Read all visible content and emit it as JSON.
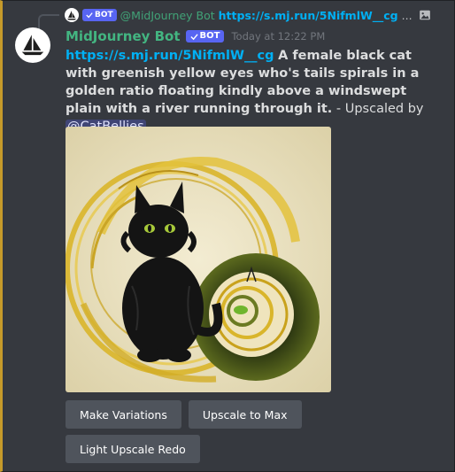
{
  "reply": {
    "bot_tag": "BOT",
    "username": "@MidJourney Bot",
    "link": "https://s.mj.run/5NifmlW__cg",
    "ellipsis": "..."
  },
  "message": {
    "username": "MidJourney Bot",
    "bot_tag": "BOT",
    "timestamp": "Today at 12:22 PM",
    "link": "https://s.mj.run/5NifmlW__cg",
    "prompt": "A female black cat with greenish yellow eyes who's tails spirals in a golden ratio floating kindly above a windswept plain with a river running through it.",
    "suffix": " - Upscaled by ",
    "mention": "@CatBellies"
  },
  "buttons": {
    "make_variations": "Make Variations",
    "upscale_to_max": "Upscale to Max",
    "light_upscale_redo": "Light Upscale Redo"
  },
  "icons": {
    "avatar": "sailboat-icon",
    "check": "check-icon",
    "image": "image-icon"
  },
  "colors": {
    "background": "#36393f",
    "username": "#43b581",
    "link": "#00b0f4",
    "bot_tag": "#5865f2",
    "button": "#4f545c",
    "highlight_border": "#c69a2a"
  }
}
